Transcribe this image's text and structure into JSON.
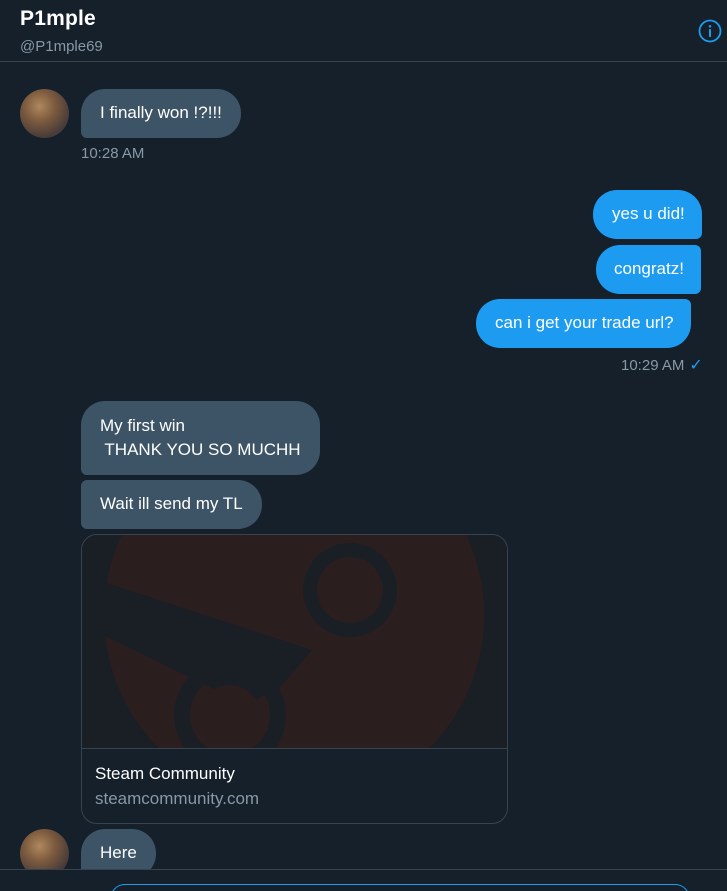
{
  "header": {
    "display_name": "P1mple",
    "handle": "@P1mple69",
    "info_icon": "info-icon"
  },
  "messages": [
    {
      "direction": "in",
      "text": "I finally won !?!!!"
    },
    {
      "direction": "in",
      "timestamp": "10:28 AM"
    },
    {
      "direction": "out",
      "text": "yes u did!"
    },
    {
      "direction": "out",
      "text": "congratz!"
    },
    {
      "direction": "out",
      "text": "can i get your trade url?"
    },
    {
      "direction": "out",
      "timestamp": "10:29 AM",
      "status_icon": "checkmark-icon"
    },
    {
      "direction": "in",
      "text": "My first win\n THANK YOU SO MUCHH"
    },
    {
      "direction": "in",
      "text": "Wait ill send my TL"
    },
    {
      "direction": "in",
      "text": "Here"
    }
  ],
  "link_card": {
    "title": "Steam Community",
    "domain": "steamcommunity.com",
    "image_icon": "steam-logo-icon"
  },
  "colors": {
    "background": "#15202b",
    "incoming_bubble": "#3d5466",
    "outgoing_bubble": "#1d9bf0",
    "secondary_text": "#8899a6",
    "border": "#38444d"
  }
}
